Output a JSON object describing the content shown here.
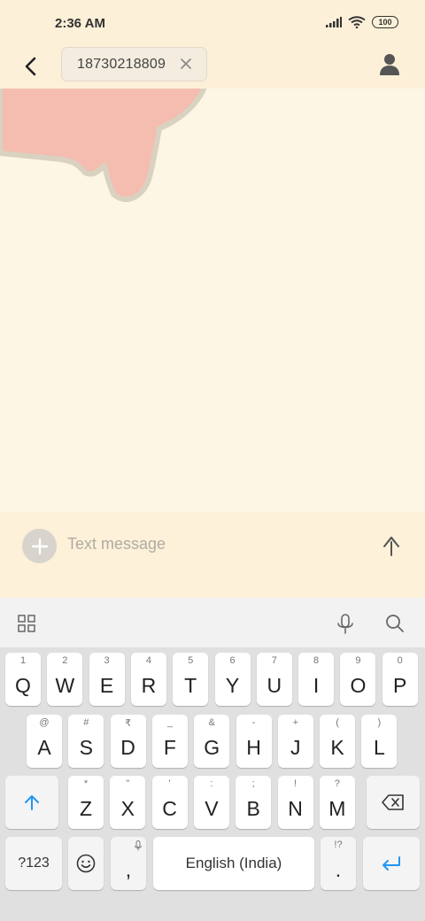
{
  "status_bar": {
    "time": "2:36 AM",
    "battery": "100"
  },
  "header": {
    "recipient": "18730218809"
  },
  "compose": {
    "placeholder": "Text message"
  },
  "keyboard": {
    "row1": [
      {
        "k": "Q",
        "h": "1"
      },
      {
        "k": "W",
        "h": "2"
      },
      {
        "k": "E",
        "h": "3"
      },
      {
        "k": "R",
        "h": "4"
      },
      {
        "k": "T",
        "h": "5"
      },
      {
        "k": "Y",
        "h": "6"
      },
      {
        "k": "U",
        "h": "7"
      },
      {
        "k": "I",
        "h": "8"
      },
      {
        "k": "O",
        "h": "9"
      },
      {
        "k": "P",
        "h": "0"
      }
    ],
    "row2": [
      {
        "k": "A",
        "h": "@"
      },
      {
        "k": "S",
        "h": "#"
      },
      {
        "k": "D",
        "h": "₹"
      },
      {
        "k": "F",
        "h": "_"
      },
      {
        "k": "G",
        "h": "&"
      },
      {
        "k": "H",
        "h": "-"
      },
      {
        "k": "J",
        "h": "+"
      },
      {
        "k": "K",
        "h": "("
      },
      {
        "k": "L",
        "h": ")"
      }
    ],
    "row3": [
      {
        "k": "Z",
        "h": "*"
      },
      {
        "k": "X",
        "h": "\""
      },
      {
        "k": "C",
        "h": "'"
      },
      {
        "k": "V",
        "h": ":"
      },
      {
        "k": "B",
        "h": ";"
      },
      {
        "k": "N",
        "h": "!"
      },
      {
        "k": "M",
        "h": "?"
      }
    ],
    "symbols_label": "?123",
    "comma": ",",
    "space_label": "English (India)",
    "period": ".",
    "period_hint": "!?"
  },
  "colors": {
    "accent": "#2196f3",
    "background": "#fef6e4"
  }
}
